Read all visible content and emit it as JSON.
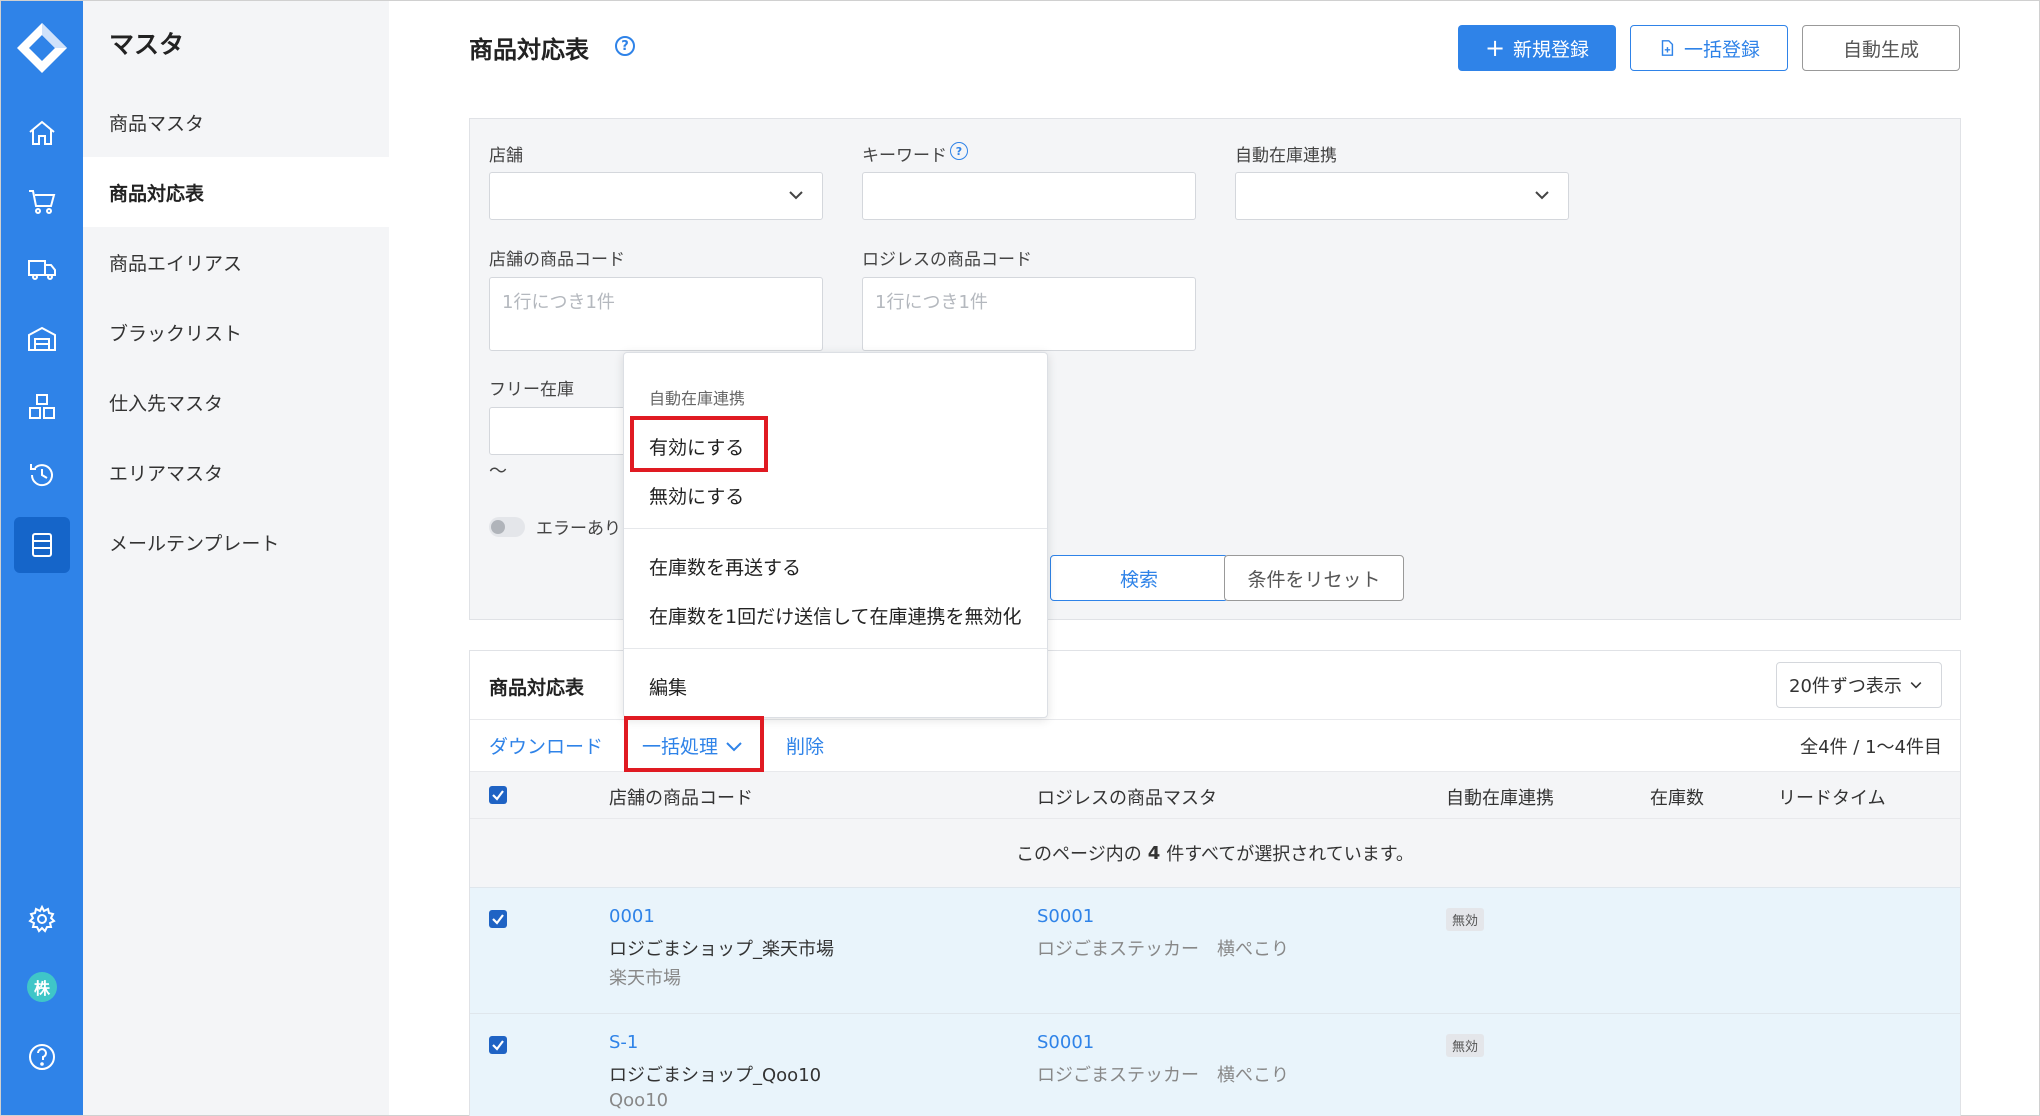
{
  "subnav": {
    "title": "マスタ",
    "items": [
      {
        "label": "商品マスタ"
      },
      {
        "label": "商品対応表"
      },
      {
        "label": "商品エイリアス"
      },
      {
        "label": "ブラックリスト"
      },
      {
        "label": "仕入先マスタ"
      },
      {
        "label": "エリアマスタ"
      },
      {
        "label": "メールテンプレート"
      }
    ]
  },
  "rail": {
    "icons": [
      "home-icon",
      "cart-icon",
      "truck-icon",
      "warehouse-icon",
      "boxes-icon",
      "history-icon",
      "master-list-icon",
      "settings-icon",
      "help-icon"
    ],
    "avatar": "株"
  },
  "header": {
    "title": "商品対応表",
    "help": "?",
    "new_button": "新規登録",
    "bulk_button": "一括登録",
    "auto_button": "自動生成"
  },
  "filter": {
    "shop_label": "店舗",
    "keyword_label": "キーワード",
    "keyword_help": "?",
    "auto_stock_label": "自動在庫連携",
    "shop_code_label": "店舗の商品コード",
    "shop_code_placeholder": "1行につき1件",
    "logi_code_label": "ロジレスの商品コード",
    "logi_code_placeholder": "1行につき1件",
    "free_stock_label": "フリー在庫",
    "range_sep": "〜",
    "error_toggle_label": "エラーあり",
    "search_button": "検索",
    "reset_button": "条件をリセット"
  },
  "menu": {
    "header": "自動在庫連携",
    "enable": "有効にする",
    "disable": "無効にする",
    "resend": "在庫数を再送する",
    "send_once": "在庫数を1回だけ送信して在庫連携を無効化",
    "edit": "編集"
  },
  "table": {
    "title": "商品対応表",
    "per_page": "20件ずつ表示",
    "download": "ダウンロード",
    "bulk": "一括処理",
    "delete": "削除",
    "count": "全4件 / 1〜4件目",
    "headers": [
      "店舗の商品コード",
      "ロジレスの商品マスタ",
      "自動在庫連携",
      "在庫数",
      "リードタイム"
    ],
    "selection_message_pre": "このページ内の",
    "selection_message_num": "4",
    "selection_message_post": "件すべてが選択されています。",
    "rows": [
      {
        "code": "0001",
        "shop": "ロジごまショップ_楽天市場",
        "mall": "楽天市場",
        "master_code": "S0001",
        "master_name": "ロジごまステッカー　横ぺこり",
        "auto": "無効"
      },
      {
        "code": "S-1",
        "shop": "ロジごまショップ_Qoo10",
        "mall": "Qoo10",
        "master_code": "S0001",
        "master_name": "ロジごまステッカー　横ぺこり",
        "auto": "無効"
      }
    ]
  },
  "colors": {
    "accent": "#2f83e8",
    "highlight": "#e01a22",
    "row_selected": "#e9f4fb"
  }
}
